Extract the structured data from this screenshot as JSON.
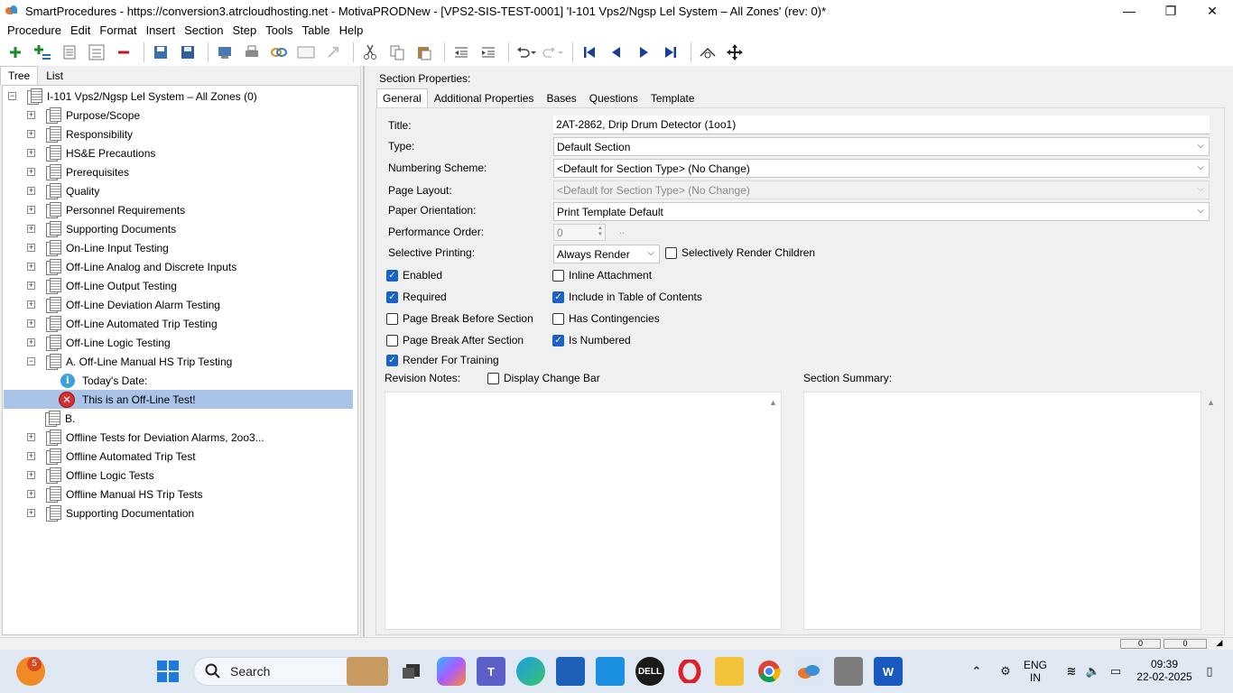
{
  "window": {
    "title": "SmartProcedures - https://conversion3.atrcloudhosting.net - MotivaPRODNew - [VPS2-SIS-TEST-0001] 'I-101 Vps2/Ngsp Lel System – All Zones' (rev: 0)*",
    "min_glyph": "—",
    "max_glyph": "❐",
    "close_glyph": "✕"
  },
  "menu": [
    "Procedure",
    "Edit",
    "Format",
    "Insert",
    "Section",
    "Step",
    "Tools",
    "Table",
    "Help"
  ],
  "toolbar_icons": [
    "add-icon",
    "add-child-icon",
    "indent-list-icon",
    "list-icon",
    "remove-icon",
    "save-copy-icon",
    "save-icon",
    "export-icon",
    "print-icon",
    "link-icon",
    "window-icon",
    "redo-disabled-icon",
    "cut-icon",
    "copy-icon",
    "paste-icon",
    "outdent-icon",
    "indent-icon",
    "undo-icon",
    "redo-icon",
    "first-icon",
    "previous-icon",
    "next-icon",
    "last-icon",
    "search-icon",
    "move-icon"
  ],
  "left": {
    "tabs": [
      "Tree",
      "List"
    ],
    "root": "I-101 Vps2/Ngsp Lel System – All Zones (0)",
    "items": [
      "Purpose/Scope",
      "Responsibility",
      "HS&E Precautions",
      "Prerequisites",
      "Quality",
      "Personnel Requirements",
      "Supporting Documents",
      "On-Line Input Testing",
      "Off-Line Analog and Discrete Inputs",
      "Off-Line Output Testing",
      "Off-Line Deviation Alarm Testing",
      "Off-Line Automated Trip Testing",
      "Off-Line Logic Testing",
      "A. Off-Line Manual HS Trip Testing",
      "Today's Date:",
      "This is an Off-Line Test!",
      "B.",
      "Offline Tests for Deviation Alarms, 2oo3...",
      "Offline Automated Trip Test",
      "Offline Logic Tests",
      "Offline Manual HS Trip Tests",
      "Supporting Documentation"
    ],
    "plus": "+",
    "minus": "−",
    "info_glyph": "i",
    "error_glyph": "✕"
  },
  "right": {
    "section_label": "Section Properties:",
    "tabs": [
      "General",
      "Additional Properties",
      "Bases",
      "Questions",
      "Template"
    ],
    "fields": {
      "title_label": "Title:",
      "title_value": "2AT-2862, Drip Drum Detector (1oo1)",
      "type_label": "Type:",
      "type_value": "Default Section",
      "numbering_label": "Numbering Scheme:",
      "numbering_value": "<Default for Section Type> (No Change)",
      "layout_label": "Page Layout:",
      "layout_value": "<Default for Section Type> (No Change)",
      "orientation_label": "Paper Orientation:",
      "orientation_value": "Print Template Default",
      "perf_label": "Performance Order:",
      "perf_value": "0",
      "perf_button": "..",
      "selective_label": "Selective Printing:",
      "selective_value": "Always Render",
      "selectively_children": "Selectively Render Children"
    },
    "checks": {
      "enabled": "Enabled",
      "inline": "Inline Attachment",
      "required": "Required",
      "toc": "Include in Table of Contents",
      "pb_before": "Page Break Before Section",
      "contingencies": "Has Contingencies",
      "pb_after": "Page Break After Section",
      "numbered": "Is Numbered",
      "training": "Render For Training",
      "change_bar": "Display Change Bar"
    },
    "check_states": {
      "enabled": true,
      "inline": false,
      "required": true,
      "toc": true,
      "pb_before": false,
      "contingencies": false,
      "pb_after": false,
      "numbered": true,
      "training": true,
      "selectively_children": false,
      "change_bar": false
    },
    "revision_label": "Revision Notes:",
    "summary_label": "Section Summary:",
    "check_glyph": "✓",
    "caret_glyph": "⌵",
    "scroll_up_glyph": "▲"
  },
  "status": {
    "box1": "0",
    "box2": "0"
  },
  "taskbar": {
    "search": "Search",
    "badge": "5",
    "lang1": "ENG",
    "lang2": "IN",
    "time": "09:39",
    "date": "22-02-2025"
  }
}
